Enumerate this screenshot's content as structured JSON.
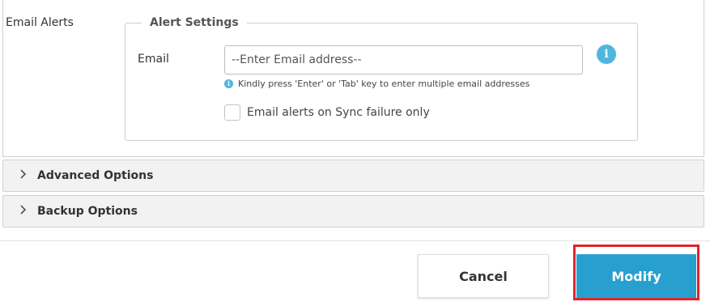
{
  "email_alerts": {
    "section_label": "Email Alerts",
    "legend": "Alert Settings",
    "email_label": "Email",
    "email_value": "",
    "email_placeholder": "--Enter Email address--",
    "hint": "Kindly press 'Enter' or 'Tab' key to enter multiple email addresses",
    "checkbox_label": "Email alerts on Sync failure only",
    "checkbox_checked": false
  },
  "accordions": [
    {
      "title": "Advanced Options",
      "expanded": false
    },
    {
      "title": "Backup Options",
      "expanded": false
    }
  ],
  "footer": {
    "cancel_label": "Cancel",
    "modify_label": "Modify"
  },
  "colors": {
    "primary": "#27a0d0",
    "info": "#4fb6de",
    "highlight": "#e0252b"
  }
}
